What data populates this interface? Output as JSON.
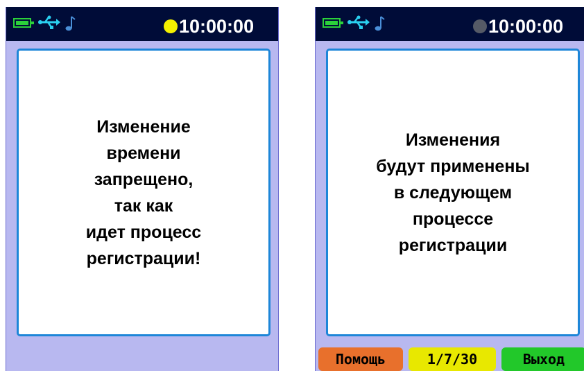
{
  "colors": {
    "status_bar": "#000c38",
    "screen_bg": "#b8b8f0",
    "panel_border": "#1d86d8",
    "battery": "#2bd13a",
    "usb_icon": "#2ad0f0",
    "note_icon": "#4a8fd8",
    "recording_active": "#f4f000",
    "recording_idle": "#555a66",
    "key_help": "#e8702c",
    "key_page": "#e8e800",
    "key_exit": "#22c82a"
  },
  "left_screen": {
    "status": {
      "icons": [
        "battery-icon",
        "usb-icon",
        "music-note-icon",
        "recording-indicator-icon"
      ],
      "recording_state": "active",
      "time": "10:00:00"
    },
    "message_lines": [
      "Изменение",
      "времени",
      "запрещено,",
      "так как",
      "идет процесс",
      "регистрации!"
    ]
  },
  "right_screen": {
    "status": {
      "icons": [
        "battery-icon",
        "usb-icon",
        "music-note-icon",
        "recording-indicator-icon"
      ],
      "recording_state": "idle",
      "time": "10:00:00"
    },
    "message_lines": [
      "Изменения",
      "будут применены",
      "в следующем",
      "процессе",
      "регистрации"
    ],
    "softkeys": {
      "help": "Помощь",
      "page": "1/7/30",
      "exit": "Выход"
    }
  }
}
